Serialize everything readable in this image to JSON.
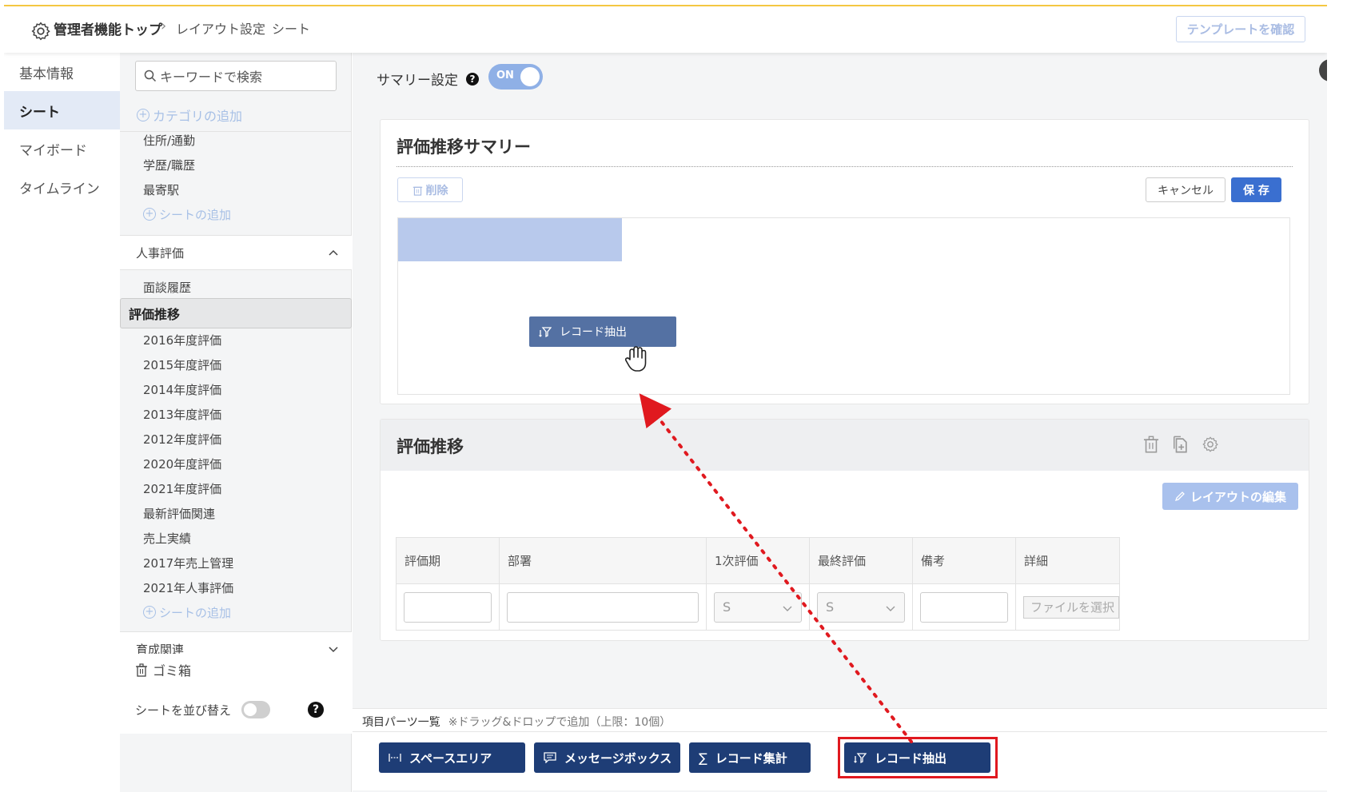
{
  "header": {
    "crumbs": [
      "管理者機能トップ",
      "レイアウト設定",
      "シート"
    ],
    "template_button": "テンプレートを確認"
  },
  "leftnav": {
    "items": [
      "基本情報",
      "シート",
      "マイボード",
      "タイムライン"
    ],
    "active": "シート"
  },
  "categories": {
    "search_placeholder": "キーワードで検索",
    "add_category": "カテゴリの追加",
    "group1_items": [
      "住所/通勤",
      "学歴/職歴",
      "最寄駅"
    ],
    "add_sheet": "シートの追加",
    "group2": {
      "title": "人事評価",
      "items": [
        "面談履歴",
        "評価推移",
        "2016年度評価",
        "2015年度評価",
        "2014年度評価",
        "2013年度評価",
        "2012年度評価",
        "2020年度評価",
        "2021年度評価",
        "最新評価関連",
        "売上実績",
        "2017年売上管理",
        "2021年人事評価"
      ],
      "selected": "評価推移"
    },
    "group3_title": "育成関連",
    "trash": "ゴミ箱",
    "sort": "シートを並び替え",
    "help": "?"
  },
  "main": {
    "summary_label": "サマリー設定",
    "help": "?",
    "toggle": "ON",
    "summary_card": {
      "title": "評価推移サマリー",
      "delete": "削除",
      "cancel": "キャンセル",
      "save": "保 存",
      "dragging_part": "レコード抽出"
    },
    "sheet_card": {
      "title": "評価推移",
      "edit_layout": "レイアウトの編集",
      "columns": [
        "評価期",
        "部署",
        "1次評価",
        "最終評価",
        "備考",
        "詳細"
      ],
      "row": {
        "first_eval": "S",
        "final_eval": "S",
        "file": "ファイルを選択"
      }
    },
    "parts": {
      "title": "項目パーツ一覧",
      "hint": "※ドラッグ&ドロップで追加（上限：10個）",
      "items": [
        "スペースエリア",
        "メッセージボックス",
        "レコード集計",
        "レコード抽出"
      ]
    }
  },
  "colors": {
    "accent": "#3a6fd0",
    "part_bg": "#1e3d76",
    "highlight": "#e0191f",
    "arrow": "#e0191f"
  }
}
